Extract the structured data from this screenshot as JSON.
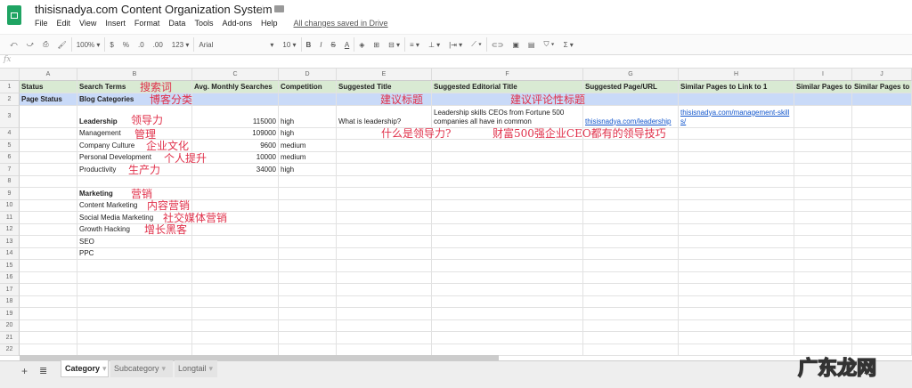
{
  "app": {
    "title": "thisisnadya.com Content Organization System",
    "saved_status": "All changes saved in Drive",
    "menu": [
      "File",
      "Edit",
      "View",
      "Insert",
      "Format",
      "Data",
      "Tools",
      "Add-ons",
      "Help"
    ]
  },
  "toolbar": {
    "undo": "⤺",
    "redo": "⤻",
    "print": "⎙",
    "paint": "🖌",
    "zoom": "100% ▾",
    "currency": "$",
    "percent": "%",
    "dec_less": ".0",
    "dec_more": ".00",
    "format": "123 ▾",
    "font": "Arial",
    "font_arrow": "▾",
    "size": "10 ▾",
    "bold": "B",
    "italic": "I",
    "strike": "S",
    "textcolor": "A",
    "fill": "◈",
    "borders": "⊞",
    "merge": "⊟ ▾",
    "halign": "≡ ▾",
    "valign": "⊥ ▾",
    "wrap": "|⇥ ▾",
    "rotate": "⟋ ▾",
    "link": "⊂⊃",
    "comment": "▣",
    "chart": "▤",
    "filter": "⛉ ▾",
    "functions": "Σ ▾"
  },
  "formula_bar": {
    "label": "fx"
  },
  "columns": [
    "A",
    "B",
    "C",
    "D",
    "E",
    "F",
    "G",
    "H",
    "I",
    "J"
  ],
  "rows": [
    [
      "Status",
      "Search Terms",
      "Avg. Monthly Searches",
      "Competition",
      "Suggested Title",
      "Suggested Editorial Title",
      "Suggested Page/URL",
      "Similar Pages to Link to 1",
      "Similar Pages to",
      "Similar Pages to"
    ],
    [
      "Page Status",
      "Blog Categories",
      "",
      "",
      "",
      "",
      "",
      "",
      "",
      ""
    ],
    [
      "",
      "Leadership",
      "115000",
      "high",
      "What is leadership?",
      "Leadership skills CEOs from Fortune 500 companies all have in common",
      "thisisnadya.com/leadership",
      "thisisnadya.com/management-skills/",
      "",
      ""
    ],
    [
      "",
      "Management",
      "109000",
      "high",
      "",
      "",
      "",
      "",
      "",
      ""
    ],
    [
      "",
      "Company Culture",
      "9600",
      "medium",
      "",
      "",
      "",
      "",
      "",
      ""
    ],
    [
      "",
      "Personal Development",
      "10000",
      "medium",
      "",
      "",
      "",
      "",
      "",
      ""
    ],
    [
      "",
      "Productivity",
      "34000",
      "high",
      "",
      "",
      "",
      "",
      "",
      ""
    ],
    [
      "",
      "",
      "",
      "",
      "",
      "",
      "",
      "",
      "",
      ""
    ],
    [
      "",
      "Marketing",
      "",
      "",
      "",
      "",
      "",
      "",
      "",
      ""
    ],
    [
      "",
      "Content Marketing",
      "",
      "",
      "",
      "",
      "",
      "",
      "",
      ""
    ],
    [
      "",
      "Social Media Marketing",
      "",
      "",
      "",
      "",
      "",
      "",
      "",
      ""
    ],
    [
      "",
      "Growth Hacking",
      "",
      "",
      "",
      "",
      "",
      "",
      "",
      ""
    ],
    [
      "",
      "SEO",
      "",
      "",
      "",
      "",
      "",
      "",
      "",
      ""
    ],
    [
      "",
      "PPC",
      "",
      "",
      "",
      "",
      "",
      "",
      "",
      ""
    ],
    [
      "",
      "",
      "",
      "",
      "",
      "",
      "",
      "",
      "",
      ""
    ],
    [
      "",
      "",
      "",
      "",
      "",
      "",
      "",
      "",
      "",
      ""
    ],
    [
      "",
      "",
      "",
      "",
      "",
      "",
      "",
      "",
      "",
      ""
    ],
    [
      "",
      "",
      "",
      "",
      "",
      "",
      "",
      "",
      "",
      ""
    ],
    [
      "",
      "",
      "",
      "",
      "",
      "",
      "",
      "",
      "",
      ""
    ],
    [
      "",
      "",
      "",
      "",
      "",
      "",
      "",
      "",
      "",
      ""
    ],
    [
      "",
      "",
      "",
      "",
      "",
      "",
      "",
      "",
      "",
      ""
    ],
    [
      "",
      "",
      "",
      "",
      "",
      "",
      "",
      "",
      "",
      ""
    ]
  ],
  "annotations": [
    "搜索词",
    "博客分类",
    "建议标题",
    "建议评论性标题",
    "领导力",
    "管理",
    "企业文化",
    "个人提升",
    "生产力",
    "什么是领导力?",
    "财富500强企业CEO都有的领导技巧",
    "营销",
    "内容营销",
    "社交媒体营销",
    "增长黑客"
  ],
  "sheets": {
    "add": "+",
    "list": "≣",
    "tabs": [
      "Category",
      "Subcategory",
      "Longtail"
    ]
  },
  "watermark": "广东龙网"
}
